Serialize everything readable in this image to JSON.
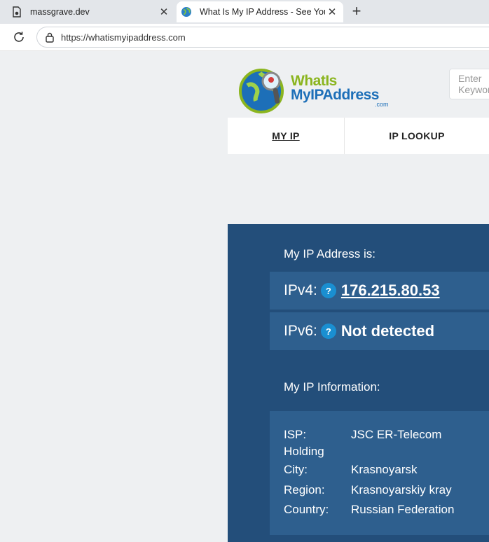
{
  "browser": {
    "tabs": [
      {
        "title": "massgrave.dev",
        "favicon": "document-icon",
        "active": false
      },
      {
        "title": "What Is My IP Address - See Your",
        "favicon": "globe-icon",
        "active": true
      }
    ],
    "new_tab_symbol": "+",
    "close_symbol": "✕",
    "url": "https://whatismyipaddress.com"
  },
  "site": {
    "logo": {
      "line1": "WhatIs",
      "line2": "MyIPAddress",
      "suffix": ".com"
    },
    "search_placeholder": "Enter Keyword",
    "nav": [
      {
        "label": "MY IP",
        "active": true
      },
      {
        "label": "IP LOOKUP",
        "active": false
      }
    ]
  },
  "panel": {
    "heading": "My IP Address is:",
    "ipv4": {
      "label": "IPv4:",
      "help": "?",
      "value": "176.215.80.53"
    },
    "ipv6": {
      "label": "IPv6:",
      "help": "?",
      "value": "Not detected"
    },
    "info_heading": "My IP Information:",
    "info": {
      "isp_label": "ISP:",
      "isp_value_line1": "JSC ER-Telecom",
      "isp_value_line2": "Holding",
      "city_label": "City:",
      "city_value": "Krasnoyarsk",
      "region_label": "Region:",
      "region_value": "Krasnoyarskiy kray",
      "country_label": "Country:",
      "country_value": "Russian Federation"
    }
  },
  "colors": {
    "panel_bg": "#234e7a",
    "row_bg": "#2e5f8e",
    "help_badge": "#1a8fd1",
    "logo_green": "#8bb51f",
    "logo_blue": "#1d6fb8"
  }
}
